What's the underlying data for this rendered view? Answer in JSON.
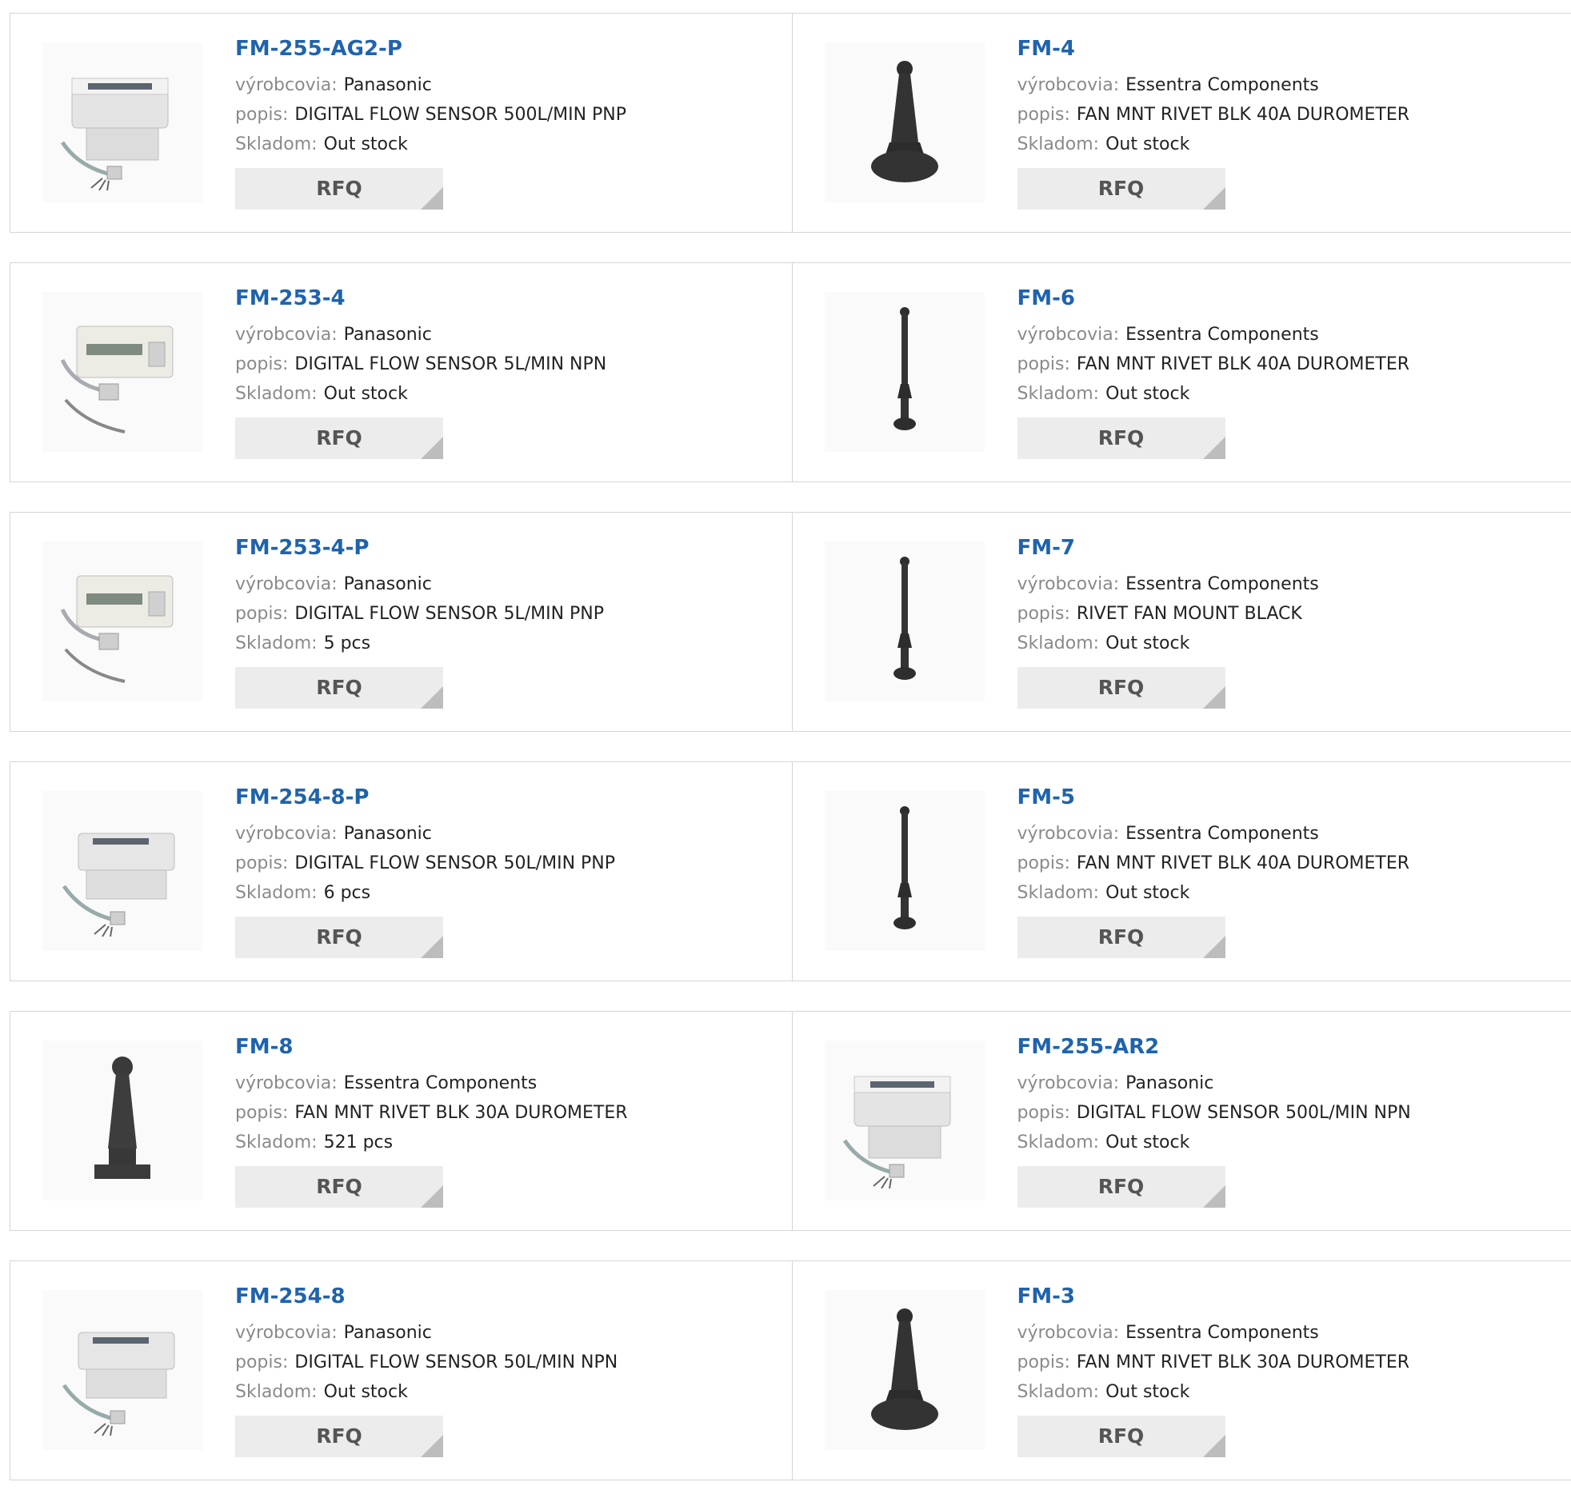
{
  "labels": {
    "manufacturer": "výrobcovia:",
    "description": "popis:",
    "stock": "Skladom:",
    "rfq": "RFQ"
  },
  "colors": {
    "part_link": "#1f63ad",
    "label": "#8a8a8a",
    "button_bg": "#ececec"
  },
  "rows": [
    {
      "left": {
        "pn": "FM-255-AG2-P",
        "mfr": "Panasonic",
        "desc": "DIGITAL FLOW SENSOR 500L/MIN PNP",
        "stock": "Out stock",
        "image": "flow-sensor-large"
      },
      "right": {
        "pn": "FM-4",
        "mfr": "Essentra Components",
        "desc": "FAN MNT RIVET BLK 40A DUROMETER",
        "stock": "Out stock",
        "image": "rivet-short"
      }
    },
    {
      "left": {
        "pn": "FM-253-4",
        "mfr": "Panasonic",
        "desc": "DIGITAL FLOW SENSOR 5L/MIN NPN",
        "stock": "Out stock",
        "image": "flow-sensor-small"
      },
      "right": {
        "pn": "FM-6",
        "mfr": "Essentra Components",
        "desc": "FAN MNT RIVET BLK 40A DUROMETER",
        "stock": "Out stock",
        "image": "rivet-long"
      }
    },
    {
      "left": {
        "pn": "FM-253-4-P",
        "mfr": "Panasonic",
        "desc": "DIGITAL FLOW SENSOR 5L/MIN PNP",
        "stock": "5 pcs",
        "image": "flow-sensor-small"
      },
      "right": {
        "pn": "FM-7",
        "mfr": "Essentra Components",
        "desc": "RIVET FAN MOUNT BLACK",
        "stock": "Out stock",
        "image": "rivet-long"
      }
    },
    {
      "left": {
        "pn": "FM-254-8-P",
        "mfr": "Panasonic",
        "desc": "DIGITAL FLOW SENSOR 50L/MIN PNP",
        "stock": "6 pcs",
        "image": "flow-sensor-medium"
      },
      "right": {
        "pn": "FM-5",
        "mfr": "Essentra Components",
        "desc": "FAN MNT RIVET BLK 40A DUROMETER",
        "stock": "Out stock",
        "image": "rivet-long"
      }
    },
    {
      "left": {
        "pn": "FM-8",
        "mfr": "Essentra Components",
        "desc": "FAN MNT RIVET BLK 30A DUROMETER",
        "stock": "521 pcs",
        "image": "rivet-cone"
      },
      "right": {
        "pn": "FM-255-AR2",
        "mfr": "Panasonic",
        "desc": "DIGITAL FLOW SENSOR 500L/MIN NPN",
        "stock": "Out stock",
        "image": "flow-sensor-large"
      }
    },
    {
      "left": {
        "pn": "FM-254-8",
        "mfr": "Panasonic",
        "desc": "DIGITAL FLOW SENSOR 50L/MIN NPN",
        "stock": "Out stock",
        "image": "flow-sensor-medium"
      },
      "right": {
        "pn": "FM-3",
        "mfr": "Essentra Components",
        "desc": "FAN MNT RIVET BLK 30A DUROMETER",
        "stock": "Out stock",
        "image": "rivet-short"
      }
    }
  ]
}
